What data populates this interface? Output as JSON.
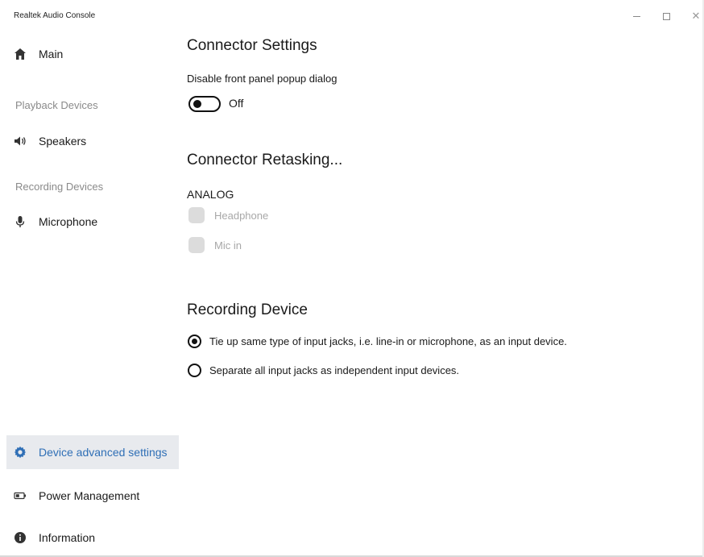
{
  "app": {
    "title": "Realtek Audio Console"
  },
  "window_controls": {
    "minimize_icon": "minimize-icon",
    "maximize_icon": "maximize-icon",
    "close_icon": "close-icon"
  },
  "sidebar": {
    "main": {
      "label": "Main",
      "icon": "home-icon"
    },
    "playback_header": "Playback Devices",
    "speakers": {
      "label": "Speakers",
      "icon": "speaker-icon"
    },
    "recording_header": "Recording Devices",
    "microphone": {
      "label": "Microphone",
      "icon": "microphone-icon"
    },
    "device_advanced": {
      "label": "Device advanced settings",
      "icon": "gear-icon",
      "selected": true
    },
    "power": {
      "label": "Power Management",
      "icon": "battery-icon"
    },
    "information": {
      "label": "Information",
      "icon": "info-icon"
    }
  },
  "connector_settings": {
    "title": "Connector Settings",
    "popup_label": "Disable front panel popup dialog",
    "toggle_state": "Off"
  },
  "connector_retasking": {
    "title": "Connector Retasking...",
    "group": "ANALOG",
    "jacks": [
      "Headphone",
      "Mic in"
    ]
  },
  "recording_device": {
    "title": "Recording Device",
    "options": [
      "Tie up same type of input jacks, i.e. line-in or microphone, as an input device.",
      "Separate all input jacks as independent input devices."
    ],
    "selected_index": 0
  },
  "colors": {
    "accent": "#2f6fb6",
    "selected_bg": "#e8eaee",
    "muted_text": "#8a8a8a"
  }
}
